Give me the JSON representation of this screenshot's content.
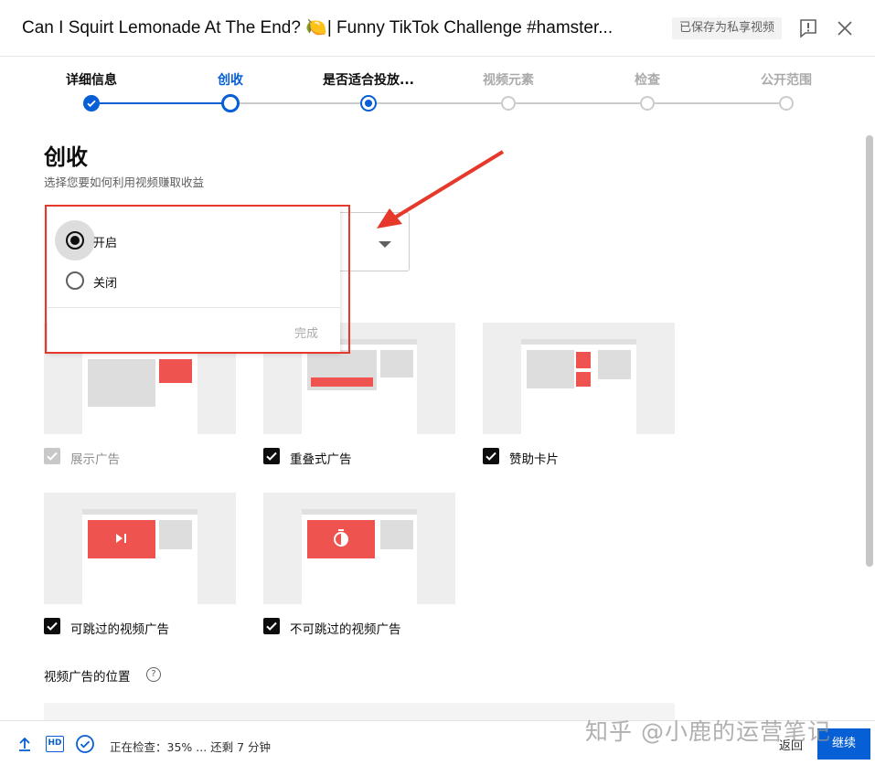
{
  "header": {
    "title": "Can I Squirt Lemonade At The End? 🍋| Funny TikTok Challenge #hamster...",
    "saved_badge": "已保存为私享视频"
  },
  "stepper": {
    "steps": [
      {
        "label": "详细信息",
        "state": "done"
      },
      {
        "label": "创收",
        "state": "current"
      },
      {
        "label": "是否适合投放...",
        "state": "active"
      },
      {
        "label": "视频元素",
        "state": "pending"
      },
      {
        "label": "检查",
        "state": "pending"
      },
      {
        "label": "公开范围",
        "state": "pending"
      }
    ]
  },
  "main": {
    "heading": "创收",
    "subtitle": "选择您要如何利用视频赚取收益"
  },
  "monetization_menu": {
    "options": [
      {
        "label": "开启",
        "selected": true
      },
      {
        "label": "关闭",
        "selected": false
      }
    ],
    "done_label": "完成"
  },
  "ad_types": [
    {
      "label": "展示广告",
      "checked": true,
      "disabled": true
    },
    {
      "label": "重叠式广告",
      "checked": true,
      "disabled": false
    },
    {
      "label": "赞助卡片",
      "checked": true,
      "disabled": false
    },
    {
      "label": "可跳过的视频广告",
      "checked": true,
      "disabled": false
    },
    {
      "label": "不可跳过的视频广告",
      "checked": true,
      "disabled": false
    }
  ],
  "video_ad_position": {
    "label": "视频广告的位置",
    "help": "?"
  },
  "footer": {
    "hd_badge": "HD",
    "status": "正在检查：35% ... 还剩 7 分钟",
    "back_label": "返回",
    "next_label": "继续"
  },
  "watermark": "知乎 @小鹿的运营笔记",
  "colors": {
    "accent": "#065fd4",
    "annotation": "#e6382b",
    "ad_red": "#ef5350"
  }
}
